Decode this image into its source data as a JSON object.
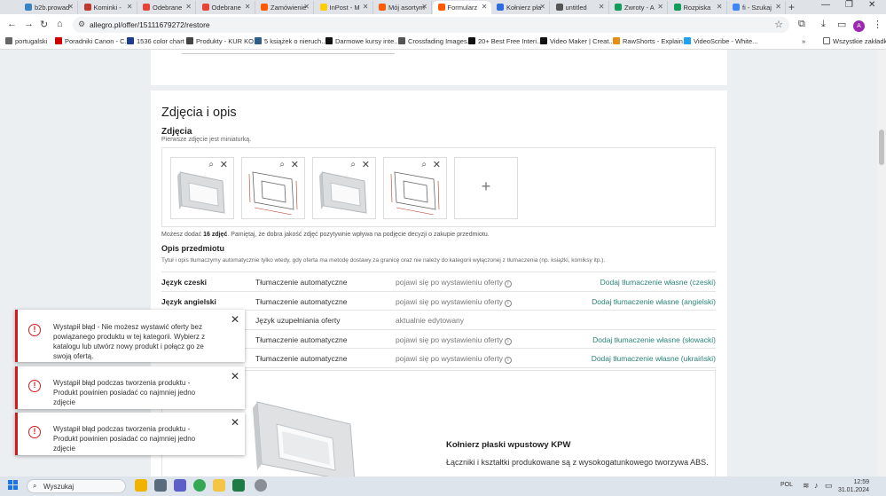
{
  "browser": {
    "tabs": [
      {
        "label": "b2b.prowad",
        "color": "#3b82c4"
      },
      {
        "label": "Kominki -",
        "color": "#c0392b"
      },
      {
        "label": "Odebrane",
        "color": "#ea4335"
      },
      {
        "label": "Odebrane",
        "color": "#ea4335"
      },
      {
        "label": "Zamówienie",
        "color": "#ff5a00"
      },
      {
        "label": "InPost - M",
        "color": "#ffcd00"
      },
      {
        "label": "Mój asortym",
        "color": "#ff5a00"
      },
      {
        "label": "Formularz",
        "color": "#ff5a00"
      },
      {
        "label": "Kołnierz pła",
        "color": "#2d6cdf"
      },
      {
        "label": "untitled",
        "color": "#555555"
      },
      {
        "label": "Zwroty - A",
        "color": "#0f9d58"
      },
      {
        "label": "Rozpiska",
        "color": "#0f9d58"
      },
      {
        "label": "fi - Szukaj",
        "color": "#4285f4"
      }
    ],
    "active_tab": 7,
    "url": "allegro.pl/offer/15111679272/restore",
    "avatar_letter": "A",
    "bookmarks": [
      {
        "label": "portugalski",
        "color": "#666666"
      },
      {
        "label": "Poradniki Canon - C...",
        "color": "#cc0000"
      },
      {
        "label": "1536 color chart",
        "color": "#1a3d8f"
      },
      {
        "label": "Produkty - KUR KO...",
        "color": "#444444"
      },
      {
        "label": "5 książek o nieruch...",
        "color": "#2c5f8a"
      },
      {
        "label": "Darmowe kursy inte...",
        "color": "#111111"
      },
      {
        "label": "Crossfading Images...",
        "color": "#555555"
      },
      {
        "label": "20+ Best Free Interi...",
        "color": "#111111"
      },
      {
        "label": "Video Maker | Creat...",
        "color": "#111111"
      },
      {
        "label": "RawShorts - Explain...",
        "color": "#e88d14"
      },
      {
        "label": "VideoScribe - White...",
        "color": "#1da1f2"
      }
    ],
    "all_bookmarks": "Wszystkie zakładki"
  },
  "photos_section": {
    "title": "Zdjęcia i opis",
    "subtitle": "Zdjęcia",
    "hint": "Pierwsze zdjęcie jest miniaturką.",
    "note_prefix": "Możesz dodać ",
    "note_bold": "16 zdjęć",
    "note_suffix": ". Pamiętaj, że dobra jakość zdjęć pozytywnie wpływa na podjęcie decyzji o zakupie przedmiotu.",
    "photos": [
      {
        "kind": "product-photo"
      },
      {
        "kind": "dimension-drawing"
      },
      {
        "kind": "product-photo"
      },
      {
        "kind": "dimension-drawing"
      }
    ],
    "add_icon": "+"
  },
  "description_section": {
    "title": "Opis przedmiotu",
    "hint": "Tytuł i opis tłumaczymy automatycznie tylko wtedy, gdy oferta ma metodę dostawy za granicę oraz nie należy do kategorii wyłączonej z tłumaczenia (np. książki, komiksy itp.).",
    "rows": [
      {
        "lang": "Język czeski",
        "mode": "Tłumaczenie automatyczne",
        "status": "pojawi się po wystawieniu oferty",
        "info": true,
        "action": "Dodaj tłumaczenie własne (czeski)"
      },
      {
        "lang": "Język angielski",
        "mode": "Tłumaczenie automatyczne",
        "status": "pojawi się po wystawieniu oferty",
        "info": true,
        "action": "Dodaj tłumaczenie własne (angielski)"
      },
      {
        "lang": "",
        "mode": "Język uzupełniania oferty",
        "status": "aktualnie edytowany",
        "info": false,
        "action": ""
      },
      {
        "lang": "",
        "mode": "Tłumaczenie automatyczne",
        "status": "pojawi się po wystawieniu oferty",
        "info": true,
        "action": "Dodaj tłumaczenie własne (słowacki)"
      },
      {
        "lang": "",
        "mode": "Tłumaczenie automatyczne",
        "status": "pojawi się po wystawieniu oferty",
        "info": true,
        "action": "Dodaj tłumaczenie własne (ukraiński)"
      }
    ],
    "info_glyph": "i"
  },
  "preview": {
    "product_name": "Kołnierz płaski wpustowy KPW",
    "product_desc": "Łączniki i kształtki produkowane są z wysokogatunkowego tworzywa ABS."
  },
  "toasts": [
    {
      "message": "Wystąpił błąd - Nie możesz wystawić oferty bez powiązanego produktu w tej kategorii. Wybierz z katalogu lub utwórz nowy produkt i połącz go ze swoją ofertą.",
      "icon": "!"
    },
    {
      "message": "Wystąpił błąd podczas tworzenia produktu - Produkt powinien posiadać co najmniej jedno zdjęcie",
      "icon": "!"
    },
    {
      "message": "Wystąpił błąd podczas tworzenia produktu - Produkt powinien posiadać co najmniej jedno zdjęcie",
      "icon": "!"
    }
  ],
  "taskbar": {
    "search_label": "Wyszukaj",
    "lang": "POL",
    "time": "12:59",
    "date": "31.01.2024"
  },
  "colors": {
    "accent_link": "#2a8476",
    "error": "#d01c1c"
  }
}
